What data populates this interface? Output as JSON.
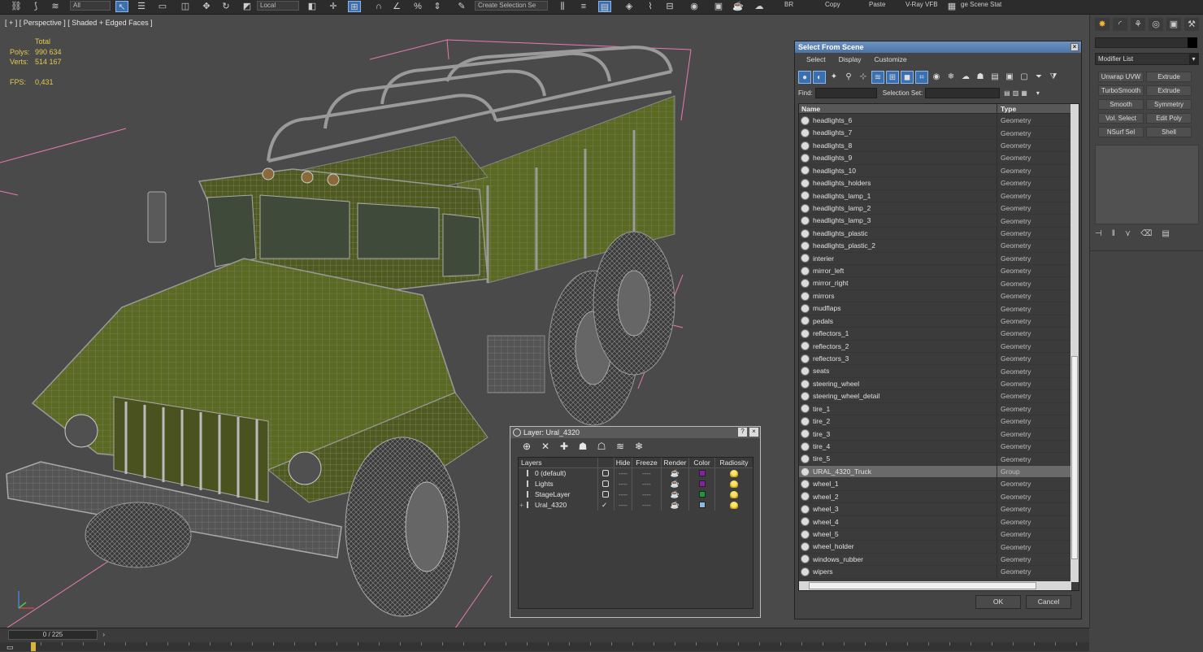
{
  "toolbar": {
    "filter_value": "All",
    "coord_value": "Local",
    "selection_set_value": "Create Selection Se",
    "labels": [
      "BR",
      "Copy",
      "Paste",
      "V-Ray VFB"
    ],
    "scene_state": "ge Scene Stat"
  },
  "viewport": {
    "label": "[ + ] [ Perspective ] [ Shaded + Edged Faces ]",
    "stats": {
      "total_label": "Total",
      "polys_label": "Polys:",
      "polys_value": "990 634",
      "verts_label": "Verts:",
      "verts_value": "514 167",
      "fps_label": "FPS:",
      "fps_value": "0,431"
    }
  },
  "select_from_scene": {
    "title": "Select From Scene",
    "menu": [
      "Select",
      "Display",
      "Customize"
    ],
    "find_label": "Find:",
    "selection_set_label": "Selection Set:",
    "columns": {
      "name": "Name",
      "type": "Type"
    },
    "rows": [
      {
        "name": "headlights_6",
        "type": "Geometry"
      },
      {
        "name": "headlights_7",
        "type": "Geometry"
      },
      {
        "name": "headlights_8",
        "type": "Geometry"
      },
      {
        "name": "headlights_9",
        "type": "Geometry"
      },
      {
        "name": "headlights_10",
        "type": "Geometry"
      },
      {
        "name": "headlights_holders",
        "type": "Geometry"
      },
      {
        "name": "headlights_lamp_1",
        "type": "Geometry"
      },
      {
        "name": "headlights_lamp_2",
        "type": "Geometry"
      },
      {
        "name": "headlights_lamp_3",
        "type": "Geometry"
      },
      {
        "name": "headlights_plastic",
        "type": "Geometry"
      },
      {
        "name": "headlights_plastic_2",
        "type": "Geometry"
      },
      {
        "name": "interier",
        "type": "Geometry"
      },
      {
        "name": "mirror_left",
        "type": "Geometry"
      },
      {
        "name": "mirror_right",
        "type": "Geometry"
      },
      {
        "name": "mirrors",
        "type": "Geometry"
      },
      {
        "name": "mudflaps",
        "type": "Geometry"
      },
      {
        "name": "pedals",
        "type": "Geometry"
      },
      {
        "name": "reflectors_1",
        "type": "Geometry"
      },
      {
        "name": "reflectors_2",
        "type": "Geometry"
      },
      {
        "name": "reflectors_3",
        "type": "Geometry"
      },
      {
        "name": "seats",
        "type": "Geometry"
      },
      {
        "name": "steering_wheel",
        "type": "Geometry"
      },
      {
        "name": "steering_wheel_detail",
        "type": "Geometry"
      },
      {
        "name": "tire_1",
        "type": "Geometry"
      },
      {
        "name": "tire_2",
        "type": "Geometry"
      },
      {
        "name": "tire_3",
        "type": "Geometry"
      },
      {
        "name": "tire_4",
        "type": "Geometry"
      },
      {
        "name": "tire_5",
        "type": "Geometry"
      },
      {
        "name": "URAL_4320_Truck",
        "type": "Group",
        "selected": true
      },
      {
        "name": "wheel_1",
        "type": "Geometry"
      },
      {
        "name": "wheel_2",
        "type": "Geometry"
      },
      {
        "name": "wheel_3",
        "type": "Geometry"
      },
      {
        "name": "wheel_4",
        "type": "Geometry"
      },
      {
        "name": "wheel_5",
        "type": "Geometry"
      },
      {
        "name": "wheel_holder",
        "type": "Geometry"
      },
      {
        "name": "windows_rubber",
        "type": "Geometry"
      },
      {
        "name": "wipers",
        "type": "Geometry"
      }
    ],
    "ok_label": "OK",
    "cancel_label": "Cancel"
  },
  "layer_dialog": {
    "title": "Layer: Ural_4320",
    "help": "?",
    "columns": [
      "Layers",
      "Hide",
      "Freeze",
      "Render",
      "Color",
      "Radiosity"
    ],
    "layers": [
      {
        "name": "0 (default)",
        "color": "#8a1fa8",
        "active": false
      },
      {
        "name": "Lights",
        "color": "#8a1fa8",
        "active": false
      },
      {
        "name": "StageLayer",
        "color": "#1f9a3a",
        "active": false
      },
      {
        "name": "Ural_4320",
        "color": "#8fb8e0",
        "active": true
      }
    ]
  },
  "command_panel": {
    "modifier_list": "Modifier List",
    "modifiers": [
      "Unwrap UVW",
      "Extrude",
      "TurboSmooth",
      "Extrude",
      "Smooth",
      "Symmetry",
      "Vol. Select",
      "Edit Poly",
      "NSurf Sel",
      "Shell"
    ]
  },
  "timeline": {
    "frame": "0 / 225"
  },
  "colors": {
    "selection_blue": "#3a6fb0",
    "stats_yellow": "#e2c94d",
    "truck_green": "#5b6a22"
  }
}
